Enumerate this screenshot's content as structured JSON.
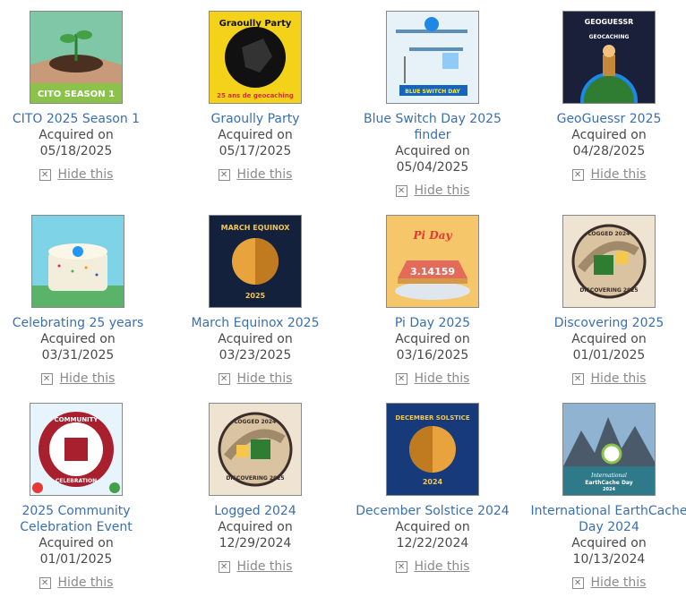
{
  "acquired_label": "Acquired on",
  "hide_label": "Hide this",
  "icon_close": "x-box-icon",
  "souvenirs": [
    {
      "name": "CITO 2025 Season 1",
      "date": "05/18/2025",
      "art_text": "CITO SEASON 1"
    },
    {
      "name": "Graoully Party",
      "date": "05/17/2025",
      "art_text": "Graoully Party",
      "art_text2": "25 ans de geocaching"
    },
    {
      "name": "Blue Switch Day 2025 finder",
      "date": "05/04/2025",
      "art_text": "BLUE SWITCH DAY"
    },
    {
      "name": "GeoGuessr 2025",
      "date": "04/28/2025",
      "art_text": "GEOGUESSR",
      "art_text2": "GEOCACHING"
    },
    {
      "name": "Celebrating 25 years",
      "date": "03/31/2025"
    },
    {
      "name": "March Equinox 2025",
      "date": "03/23/2025",
      "art_text": "MARCH EQUINOX",
      "art_text2": "2025"
    },
    {
      "name": "Pi Day 2025",
      "date": "03/16/2025",
      "art_text": "Pi Day",
      "art_text2": "3.14159"
    },
    {
      "name": "Discovering 2025",
      "date": "01/01/2025",
      "art_text": "LOGGED 2024",
      "art_text2": "DISCOVERING 2025"
    },
    {
      "name": "2025 Community Celebration Event",
      "date": "01/01/2025",
      "art_text": "COMMUNITY",
      "art_text2": "CELEBRATION"
    },
    {
      "name": "Logged 2024",
      "date": "12/29/2024",
      "art_text": "LOGGED 2024",
      "art_text2": "DISCOVERING 2025"
    },
    {
      "name": "December Solstice 2024",
      "date": "12/22/2024",
      "art_text": "DECEMBER SOLSTICE",
      "art_text2": "2024"
    },
    {
      "name": "International EarthCache Day 2024",
      "date": "10/13/2024",
      "art_text": "International",
      "art_text2": "EarthCache Day",
      "art_text3": "2024"
    }
  ]
}
